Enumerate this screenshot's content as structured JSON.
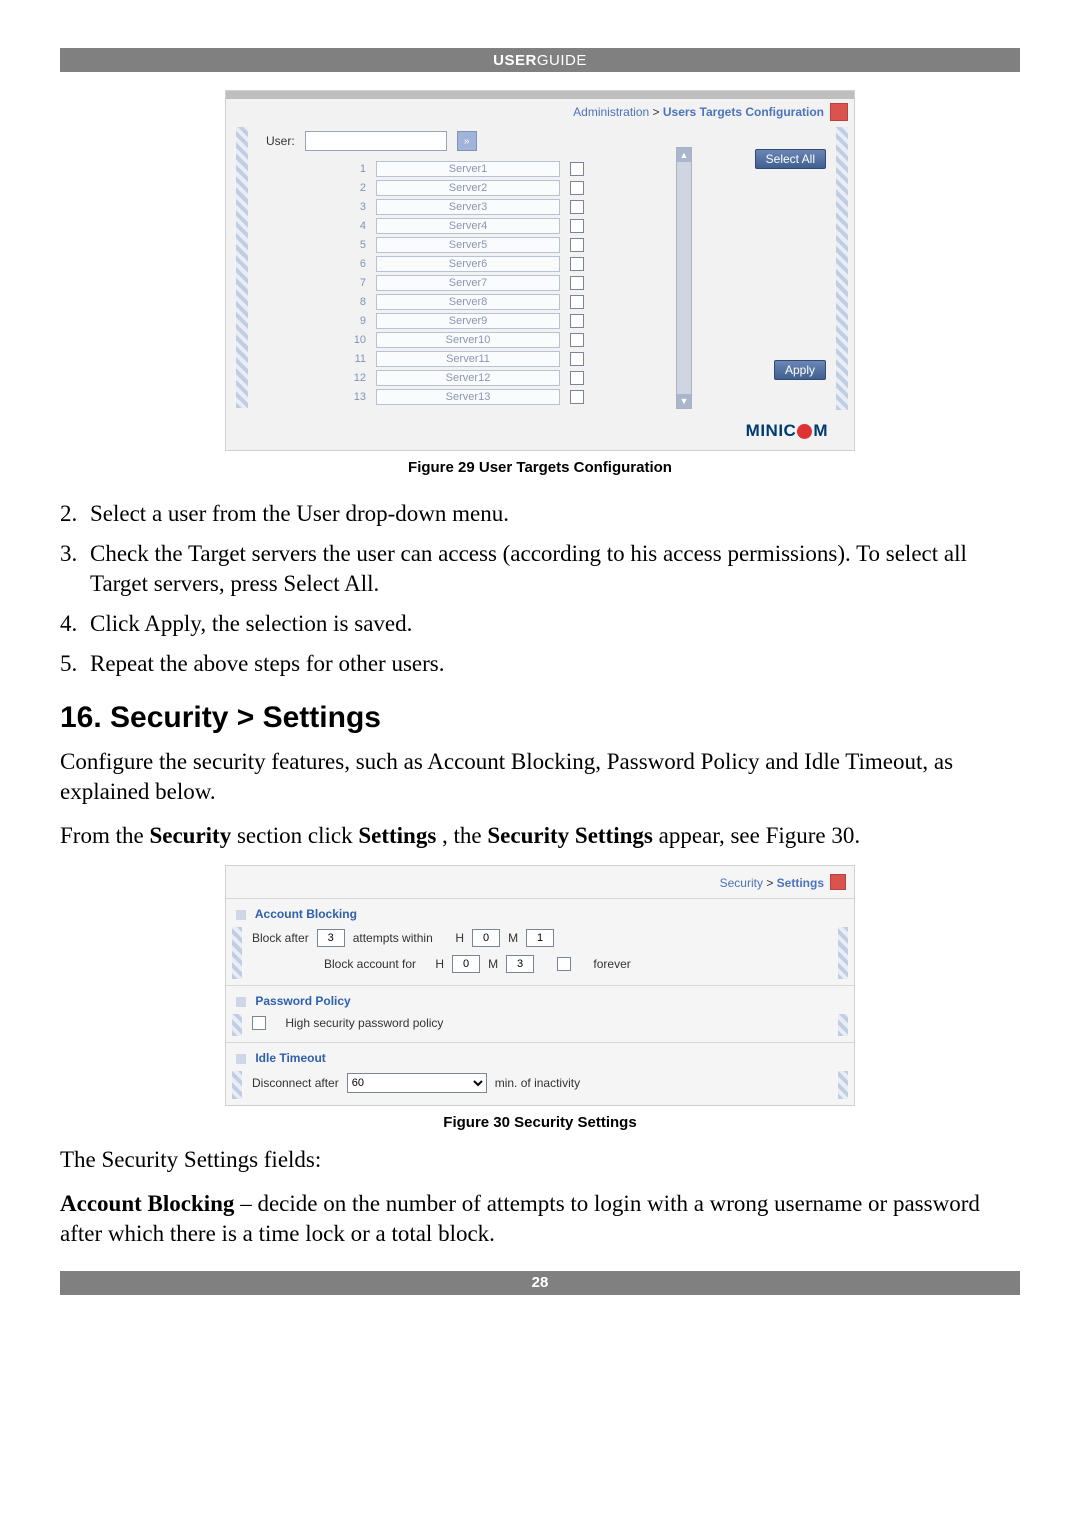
{
  "header": {
    "left": "USER ",
    "right": "GUIDE"
  },
  "figure29": {
    "breadcrumb": {
      "section": "Administration",
      "page": "Users Targets Configuration",
      "sep": " > "
    },
    "user_label": "User:",
    "go_icon_text": "»",
    "servers": [
      {
        "n": "1",
        "name": "Server1"
      },
      {
        "n": "2",
        "name": "Server2"
      },
      {
        "n": "3",
        "name": "Server3"
      },
      {
        "n": "4",
        "name": "Server4"
      },
      {
        "n": "5",
        "name": "Server5"
      },
      {
        "n": "6",
        "name": "Server6"
      },
      {
        "n": "7",
        "name": "Server7"
      },
      {
        "n": "8",
        "name": "Server8"
      },
      {
        "n": "9",
        "name": "Server9"
      },
      {
        "n": "10",
        "name": "Server10"
      },
      {
        "n": "11",
        "name": "Server11"
      },
      {
        "n": "12",
        "name": "Server12"
      },
      {
        "n": "13",
        "name": "Server13"
      }
    ],
    "select_all_label": "Select All",
    "apply_label": "Apply",
    "brand": {
      "pre": "MINIC",
      "post": "M"
    },
    "caption": "Figure 29 User Targets Configuration"
  },
  "steps": {
    "s2": " Select a user from the User drop-down menu.",
    "s3": "Check the Target servers the user can access (according to his access permissions). To select all Target servers, press Select All.",
    "s4": "Click Apply, the selection is saved.",
    "s5": "Repeat the above steps for other users."
  },
  "section16": {
    "heading": "16. Security > Settings",
    "para1": "Configure the security features, such as Account Blocking, Password Policy and Idle Timeout, as explained below.",
    "para2_pre": "From the ",
    "para2_b1": "Security",
    "para2_mid1": " section click ",
    "para2_b2": "Settings",
    "para2_mid2": ", the ",
    "para2_b3": "Security Settings",
    "para2_post": " appear, see Figure 30."
  },
  "figure30": {
    "breadcrumb": {
      "section": "Security",
      "page": "Settings",
      "sep": " > "
    },
    "account_blocking": {
      "title": "Account Blocking",
      "block_after_label": "Block after",
      "block_after_value": "3",
      "attempts_within_label": "attempts within",
      "h1_label": "H",
      "h1_value": "0",
      "m1_label": "M",
      "m1_value": "1",
      "block_acct_for_label": "Block account for",
      "h2_label": "H",
      "h2_value": "0",
      "m2_label": "M",
      "m2_value": "3",
      "forever_label": "forever"
    },
    "password_policy": {
      "title": "Password Policy",
      "hs_label": "High security password policy"
    },
    "idle_timeout": {
      "title": "Idle Timeout",
      "disconnect_label": "Disconnect after",
      "disconnect_value": "60",
      "minutes_label": "min. of inactivity"
    },
    "caption": "Figure 30 Security Settings"
  },
  "tail": {
    "fields_intro": "The Security Settings fields:",
    "acct_block_bold": "Account Blocking",
    "acct_block_rest": " – decide on the number of attempts to login with a wrong username or password after which there is a time lock or a total block."
  },
  "page_number": "28"
}
